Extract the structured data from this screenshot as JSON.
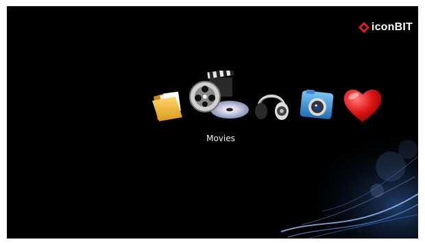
{
  "brand": {
    "logo_icon": "iconbit-diamond-logo-icon",
    "name": "iconBIT",
    "accent": "#e0201b"
  },
  "menu": {
    "selected_label": "Movies",
    "items": [
      {
        "id": "folder",
        "icon": "folder-icon"
      },
      {
        "id": "movies",
        "icon": "film-reel-disc-icon",
        "selected": true
      },
      {
        "id": "music",
        "icon": "headphones-icon"
      },
      {
        "id": "photo",
        "icon": "camera-icon"
      },
      {
        "id": "favorites",
        "icon": "heart-icon"
      }
    ]
  },
  "colors": {
    "background": "#000000",
    "swoosh": "#3a6fc0",
    "caption": "#f2f2f2"
  }
}
